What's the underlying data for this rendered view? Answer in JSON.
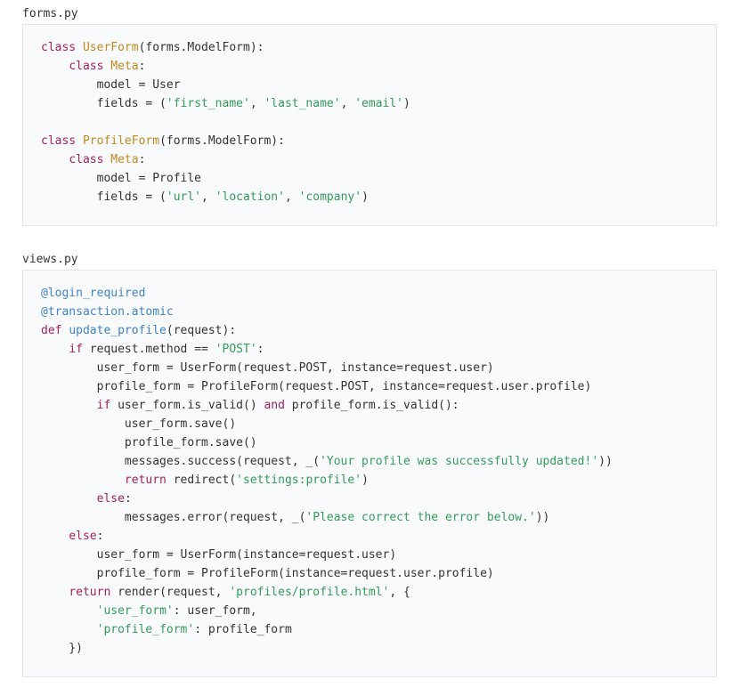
{
  "files": [
    {
      "name": "forms.py",
      "lines": [
        [
          {
            "t": "class",
            "c": "kw"
          },
          {
            "t": " ",
            "c": "plain"
          },
          {
            "t": "UserForm",
            "c": "cls"
          },
          {
            "t": "(forms.ModelForm):",
            "c": "plain"
          }
        ],
        [
          {
            "t": "    ",
            "c": "plain"
          },
          {
            "t": "class",
            "c": "kw"
          },
          {
            "t": " ",
            "c": "plain"
          },
          {
            "t": "Meta",
            "c": "cls"
          },
          {
            "t": ":",
            "c": "plain"
          }
        ],
        [
          {
            "t": "        model = User",
            "c": "plain"
          }
        ],
        [
          {
            "t": "        fields = (",
            "c": "plain"
          },
          {
            "t": "'first_name'",
            "c": "str"
          },
          {
            "t": ", ",
            "c": "plain"
          },
          {
            "t": "'last_name'",
            "c": "str"
          },
          {
            "t": ", ",
            "c": "plain"
          },
          {
            "t": "'email'",
            "c": "str"
          },
          {
            "t": ")",
            "c": "plain"
          }
        ],
        [],
        [
          {
            "t": "class",
            "c": "kw"
          },
          {
            "t": " ",
            "c": "plain"
          },
          {
            "t": "ProfileForm",
            "c": "cls"
          },
          {
            "t": "(forms.ModelForm):",
            "c": "plain"
          }
        ],
        [
          {
            "t": "    ",
            "c": "plain"
          },
          {
            "t": "class",
            "c": "kw"
          },
          {
            "t": " ",
            "c": "plain"
          },
          {
            "t": "Meta",
            "c": "cls"
          },
          {
            "t": ":",
            "c": "plain"
          }
        ],
        [
          {
            "t": "        model = Profile",
            "c": "plain"
          }
        ],
        [
          {
            "t": "        fields = (",
            "c": "plain"
          },
          {
            "t": "'url'",
            "c": "str"
          },
          {
            "t": ", ",
            "c": "plain"
          },
          {
            "t": "'location'",
            "c": "str"
          },
          {
            "t": ", ",
            "c": "plain"
          },
          {
            "t": "'company'",
            "c": "str"
          },
          {
            "t": ")",
            "c": "plain"
          }
        ]
      ]
    },
    {
      "name": "views.py",
      "lines": [
        [
          {
            "t": "@login_required",
            "c": "dec"
          }
        ],
        [
          {
            "t": "@transaction.atomic",
            "c": "dec"
          }
        ],
        [
          {
            "t": "def",
            "c": "kw"
          },
          {
            "t": " ",
            "c": "plain"
          },
          {
            "t": "update_profile",
            "c": "fn"
          },
          {
            "t": "(request):",
            "c": "plain"
          }
        ],
        [
          {
            "t": "    ",
            "c": "plain"
          },
          {
            "t": "if",
            "c": "kw"
          },
          {
            "t": " request.method == ",
            "c": "plain"
          },
          {
            "t": "'POST'",
            "c": "str"
          },
          {
            "t": ":",
            "c": "plain"
          }
        ],
        [
          {
            "t": "        user_form = UserForm(request.POST, instance=request.user)",
            "c": "plain"
          }
        ],
        [
          {
            "t": "        profile_form = ProfileForm(request.POST, instance=request.user.profile)",
            "c": "plain"
          }
        ],
        [
          {
            "t": "        ",
            "c": "plain"
          },
          {
            "t": "if",
            "c": "kw"
          },
          {
            "t": " user_form.is_valid() ",
            "c": "plain"
          },
          {
            "t": "and",
            "c": "kw"
          },
          {
            "t": " profile_form.is_valid():",
            "c": "plain"
          }
        ],
        [
          {
            "t": "            user_form.save()",
            "c": "plain"
          }
        ],
        [
          {
            "t": "            profile_form.save()",
            "c": "plain"
          }
        ],
        [
          {
            "t": "            messages.success(request, _(",
            "c": "plain"
          },
          {
            "t": "'Your profile was successfully updated!'",
            "c": "str"
          },
          {
            "t": "))",
            "c": "plain"
          }
        ],
        [
          {
            "t": "            ",
            "c": "plain"
          },
          {
            "t": "return",
            "c": "kw"
          },
          {
            "t": " redirect(",
            "c": "plain"
          },
          {
            "t": "'settings:profile'",
            "c": "str"
          },
          {
            "t": ")",
            "c": "plain"
          }
        ],
        [
          {
            "t": "        ",
            "c": "plain"
          },
          {
            "t": "else",
            "c": "kw"
          },
          {
            "t": ":",
            "c": "plain"
          }
        ],
        [
          {
            "t": "            messages.error(request, _(",
            "c": "plain"
          },
          {
            "t": "'Please correct the error below.'",
            "c": "str"
          },
          {
            "t": "))",
            "c": "plain"
          }
        ],
        [
          {
            "t": "    ",
            "c": "plain"
          },
          {
            "t": "else",
            "c": "kw"
          },
          {
            "t": ":",
            "c": "plain"
          }
        ],
        [
          {
            "t": "        user_form = UserForm(instance=request.user)",
            "c": "plain"
          }
        ],
        [
          {
            "t": "        profile_form = ProfileForm(instance=request.user.profile)",
            "c": "plain"
          }
        ],
        [
          {
            "t": "    ",
            "c": "plain"
          },
          {
            "t": "return",
            "c": "kw"
          },
          {
            "t": " render(request, ",
            "c": "plain"
          },
          {
            "t": "'profiles/profile.html'",
            "c": "str"
          },
          {
            "t": ", {",
            "c": "plain"
          }
        ],
        [
          {
            "t": "        ",
            "c": "plain"
          },
          {
            "t": "'user_form'",
            "c": "str"
          },
          {
            "t": ": user_form,",
            "c": "plain"
          }
        ],
        [
          {
            "t": "        ",
            "c": "plain"
          },
          {
            "t": "'profile_form'",
            "c": "str"
          },
          {
            "t": ": profile_form",
            "c": "plain"
          }
        ],
        [
          {
            "t": "    })",
            "c": "plain"
          }
        ]
      ]
    }
  ]
}
